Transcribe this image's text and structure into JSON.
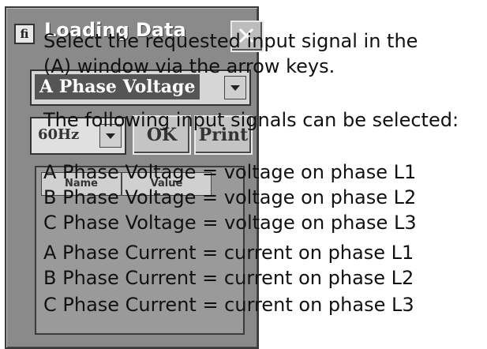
{
  "dialog": {
    "title": "Loading Data",
    "title_icon_glyph": "fi",
    "close_icon": "close-icon",
    "signal_select": {
      "value": "A Phase Voltage"
    },
    "frequency_select": {
      "value": "60Hz"
    },
    "ok_label": "OK",
    "print_label": "Print",
    "table_headers": [
      "Name",
      "Value"
    ]
  },
  "instructions": {
    "line1": "Select the requested input signal in the",
    "line2": "(A) window via the arrow keys.",
    "line3": "The following input signals can be selected:",
    "signals": [
      "A Phase Voltage = voltage on phase L1",
      "B Phase Voltage = voltage on phase L2",
      "C Phase Voltage = voltage on phase L3",
      "A Phase Current = current on phase L1",
      "B Phase Current = current on phase L2",
      "C Phase Current = current on phase L3"
    ]
  }
}
